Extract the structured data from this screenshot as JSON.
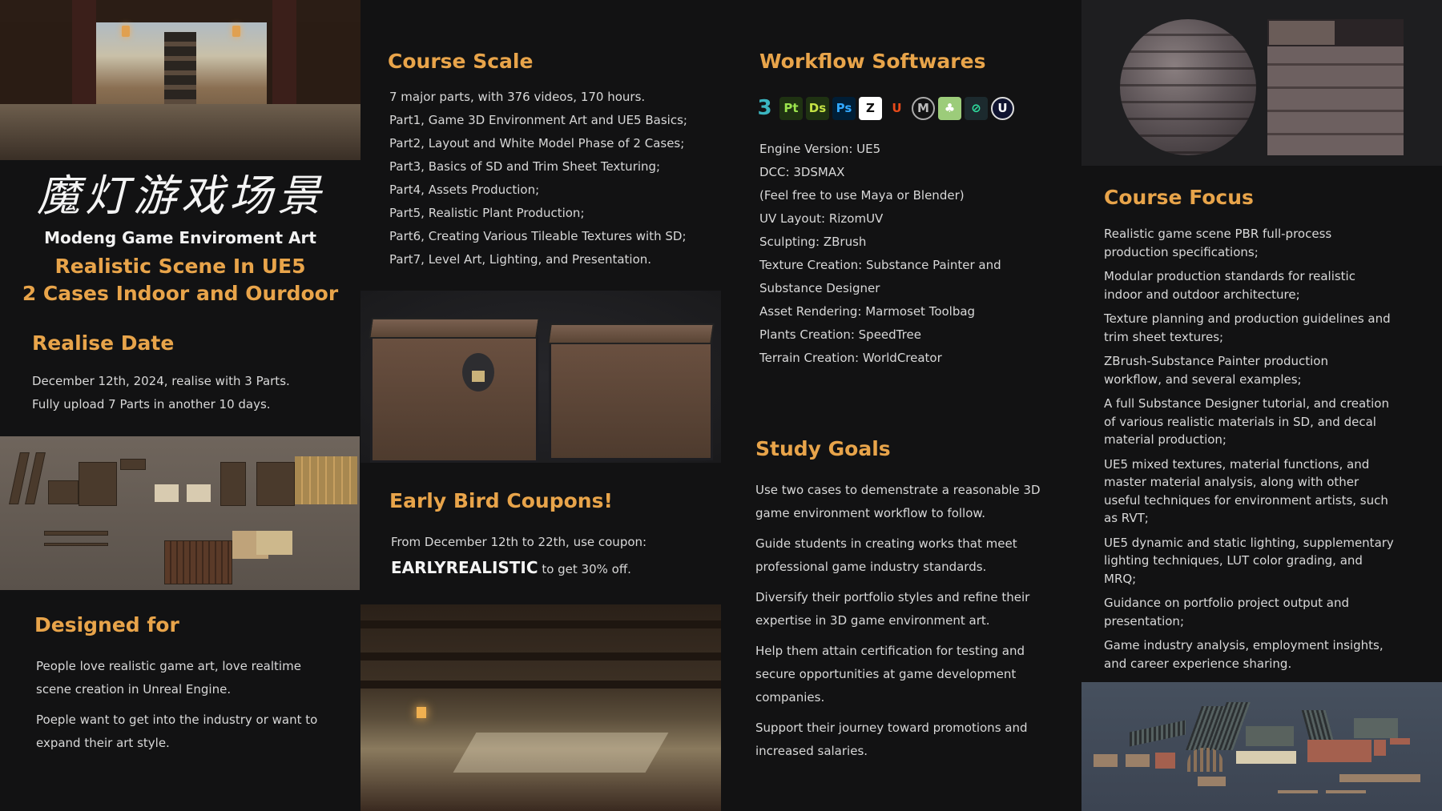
{
  "colors": {
    "accent": "#E8A44A",
    "background": "#121213",
    "text": "#D8D8D8"
  },
  "left": {
    "calligraphy": "魔灯游戏场景",
    "brand": "Modeng Game Enviroment Art",
    "tagline_1": "Realistic Scene In UE5",
    "tagline_2": "2 Cases Indoor and Ourdoor",
    "release": {
      "heading": "Realise Date",
      "lines": [
        "December 12th, 2024, realise with 3 Parts.",
        "Fully upload 7 Parts in another 10 days."
      ]
    },
    "designed_for": {
      "heading": "Designed for",
      "lines": [
        "People love realistic game art, love realtime",
        "scene creation in Unreal Engine.",
        "Poeple want to get into the industry or want to",
        "expand their art style."
      ]
    }
  },
  "course_scale": {
    "heading": "Course Scale",
    "lines": [
      "7 major parts, with 376 videos, 170 hours.",
      "Part1, Game 3D Environment Art and UE5 Basics;",
      "Part2, Layout and White Model Phase of 2 Cases;",
      "Part3, Basics of SD and Trim Sheet Texturing;",
      "Part4, Assets Production;",
      "Part5, Realistic Plant Production;",
      "Part6, Creating Various Tileable Textures with SD;",
      "Part7,  Level Art, Lighting, and Presentation."
    ]
  },
  "coupon": {
    "heading": "Early Bird Coupons!",
    "line": "From December 12th to 22th, use coupon:",
    "code": "EARLYREALISTIC",
    "suffix": "to get 30% off."
  },
  "workflow": {
    "heading": "Workflow Softwares",
    "icons": [
      {
        "name": "3dsmax-icon",
        "label": "3",
        "bg": "transparent",
        "fg": "#3bb5c0"
      },
      {
        "name": "substance-painter-icon",
        "label": "Pt",
        "bg": "#1f3212",
        "fg": "#9be34d"
      },
      {
        "name": "substance-designer-icon",
        "label": "Ds",
        "bg": "#1f3212",
        "fg": "#c5e344"
      },
      {
        "name": "photoshop-icon",
        "label": "Ps",
        "bg": "#001e36",
        "fg": "#31a8ff"
      },
      {
        "name": "zbrush-icon",
        "label": "Z",
        "bg": "#ffffff",
        "fg": "#111111"
      },
      {
        "name": "rizomuv-icon",
        "label": "U",
        "bg": "transparent",
        "fg": "#e84a1a"
      },
      {
        "name": "marmoset-icon",
        "label": "M",
        "bg": "transparent",
        "fg": "#bbbbbb"
      },
      {
        "name": "speedtree-icon",
        "label": "♣",
        "bg": "#9ccc7a",
        "fg": "#ffffff"
      },
      {
        "name": "worldcreator-icon",
        "label": "⊘",
        "bg": "#1c2a2e",
        "fg": "#2fe0a0"
      },
      {
        "name": "unreal-engine-icon",
        "label": "U",
        "bg": "#0f1330",
        "fg": "#ffffff"
      }
    ],
    "lines": [
      "Engine Version:  UE5",
      "DCC: 3DSMAX",
      "(Feel free to use Maya or Blender)",
      "UV Layout: RizomUV",
      "Sculpting: ZBrush",
      "Texture Creation: Substance Painter and",
      "Substance Designer",
      "Asset Rendering: Marmoset Toolbag",
      "Plants Creation: SpeedTree",
      "Terrain Creation: WorldCreator"
    ]
  },
  "study_goals": {
    "heading": "Study Goals",
    "lines": [
      "Use two cases to demenstrate a reasonable 3D",
      "game environment workflow to follow.",
      "Guide students in creating works that meet",
      "professional game industry standards.",
      "Diversify their portfolio styles and refine their",
      "expertise in 3D game environment art.",
      "Help them attain certification for testing and",
      "secure opportunities at game development",
      "companies.",
      "Support their journey toward promotions and",
      "increased salaries."
    ]
  },
  "course_focus": {
    "heading": "Course Focus",
    "lines": [
      "Realistic game scene PBR full-process",
      "production specifications;",
      "Modular production standards for realistic",
      "indoor and outdoor architecture;",
      "Texture planning and production guidelines and",
      "trim sheet textures;",
      "ZBrush-Substance Painter production",
      "workflow, and several examples;",
      "A full Substance Designer tutorial, and creation",
      "of various realistic materials in SD, and decal",
      "material production;",
      "UE5 mixed textures, material functions, and",
      "master material analysis, along with other",
      "useful techniques for environment artists, such",
      "as RVT;",
      "UE5 dynamic and static lighting, supplementary",
      "lighting techniques, LUT color grading, and",
      "MRQ;",
      "Guidance on portfolio project output and",
      "presentation;",
      "Game industry analysis, employment insights,",
      "and career experience sharing."
    ]
  }
}
